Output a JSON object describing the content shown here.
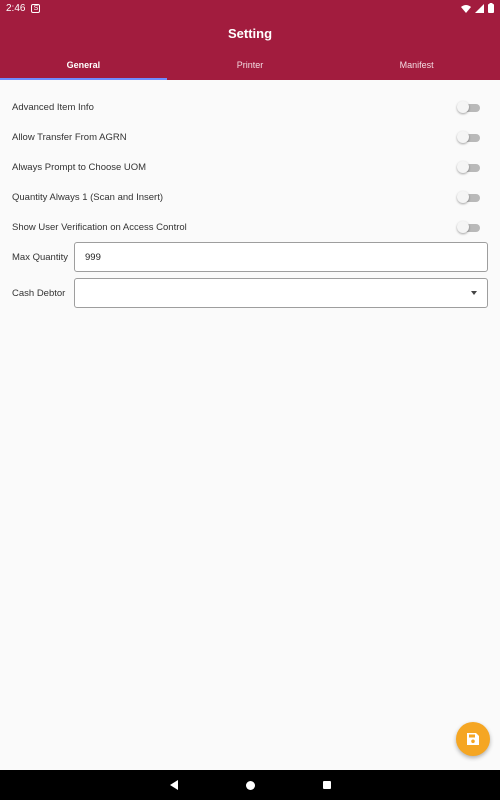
{
  "status_bar": {
    "time": "2:46",
    "notification_icon": "sim-notification-icon",
    "icons": [
      "wifi-icon",
      "signal-icon",
      "battery-icon"
    ]
  },
  "app_bar": {
    "title": "Setting",
    "background_color": "#a21c3e",
    "tabs": [
      {
        "label": "General",
        "active": true
      },
      {
        "label": "Printer",
        "active": false
      },
      {
        "label": "Manifest",
        "active": false
      }
    ],
    "tab_indicator_color": "#6e8dff"
  },
  "settings": {
    "toggles": [
      {
        "label": "Advanced Item Info",
        "on": false
      },
      {
        "label": "Allow Transfer From AGRN",
        "on": false
      },
      {
        "label": "Always Prompt to Choose UOM",
        "on": false
      },
      {
        "label": "Quantity Always 1 (Scan and Insert)",
        "on": false
      },
      {
        "label": "Show User Verification on Access Control",
        "on": false
      }
    ],
    "max_quantity": {
      "label": "Max Quantity",
      "value": "999"
    },
    "cash_debtor": {
      "label": "Cash Debtor",
      "value": ""
    }
  },
  "fab": {
    "icon": "save-icon",
    "color": "#f5a623"
  },
  "nav_bar": {
    "icons": [
      "back-icon",
      "home-icon",
      "recents-icon"
    ]
  }
}
